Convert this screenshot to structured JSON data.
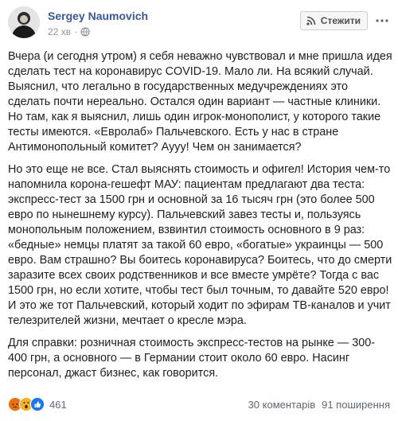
{
  "post": {
    "author": "Sergey Naumovich",
    "time": "22 хв",
    "follow_label": "Стежити",
    "paragraphs": [
      "Вчера (и сегодня утром) я себя неважно чувствовал и мне пришла идея сделать тест на коронавирус COVID-19. Мало ли. На всякий случай. Выяснил, что легально в государственных медучреждениях это сделать почти нереально. Остался один вариант — частные клиники. Но там, как я выяснил, лишь один игрок-монополист, у которого такие тесты имеются. «Евролаб» Пальчевского. Есть у нас в стране Антимонопольный комитет? Аууу! Чем он занимается?",
      "Но это еще не все. Стал выяснять стоимость и офигел! История чем-то напомнила корона-гешефт МАУ: пациентам предлагают два теста: экспресс-тест за 1500 грн и основной за 16 тысяч грн (это более 500 евро по нынешнему курсу). Пальчевский завез тесты и, пользуясь монопольным положением, взвинтил стоимость основного в 9 раз: «бедные» немцы платят за такой 60 евро, «богатые» украинцы — 500 евро. Вам страшно? Вы боитесь коронавируса? Боитесь, что до смерти заразите всех своих родственников и все вместе умрёте? Тогда с вас 1500 грн, но если хотите, чтобы тест был точным, то давайте 520 евро! И это же тот Пальчевский, который ходит по эфирам ТВ-каналов и учит телезрителей жизни, мечтает о кресле мэра.",
      "Для справки: розничная стоимость экспресс-тестов на рынке — 300-400 грн, а основного — в Германии стоит около 60 евро. Насинг персонал, джаст бизнес, как говорится."
    ]
  },
  "footer": {
    "reaction_count": "461",
    "comments": "30 коментарів",
    "shares": "91 поширення"
  },
  "icons": {
    "avatar": "avatar",
    "globe": "globe-icon",
    "rss": "rss-icon",
    "more": "more-icon",
    "reactions": [
      "angry-icon",
      "wow-icon",
      "like-icon"
    ]
  },
  "colors": {
    "author": "#385898",
    "meta": "#90949c",
    "like": "#1877f2",
    "angry": "#e9710f",
    "wow": "#f7b125"
  }
}
